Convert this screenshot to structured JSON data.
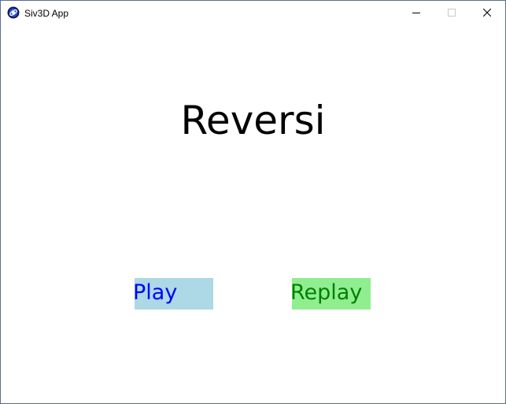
{
  "window": {
    "title": "Siv3D App",
    "app_icon": "siv3d-logo-icon",
    "controls": {
      "minimize_icon": "minimize-icon",
      "maximize_icon": "maximize-icon",
      "close_icon": "close-icon"
    }
  },
  "scene": {
    "title": "Reversi",
    "buttons": {
      "play_label": "Play",
      "replay_label": "Replay"
    }
  },
  "colors": {
    "play_bg": "#add8e6",
    "play_text": "#0000ff",
    "replay_bg": "#90ee90",
    "replay_text": "#008000",
    "title_text": "#000000",
    "background": "#ffffff"
  }
}
